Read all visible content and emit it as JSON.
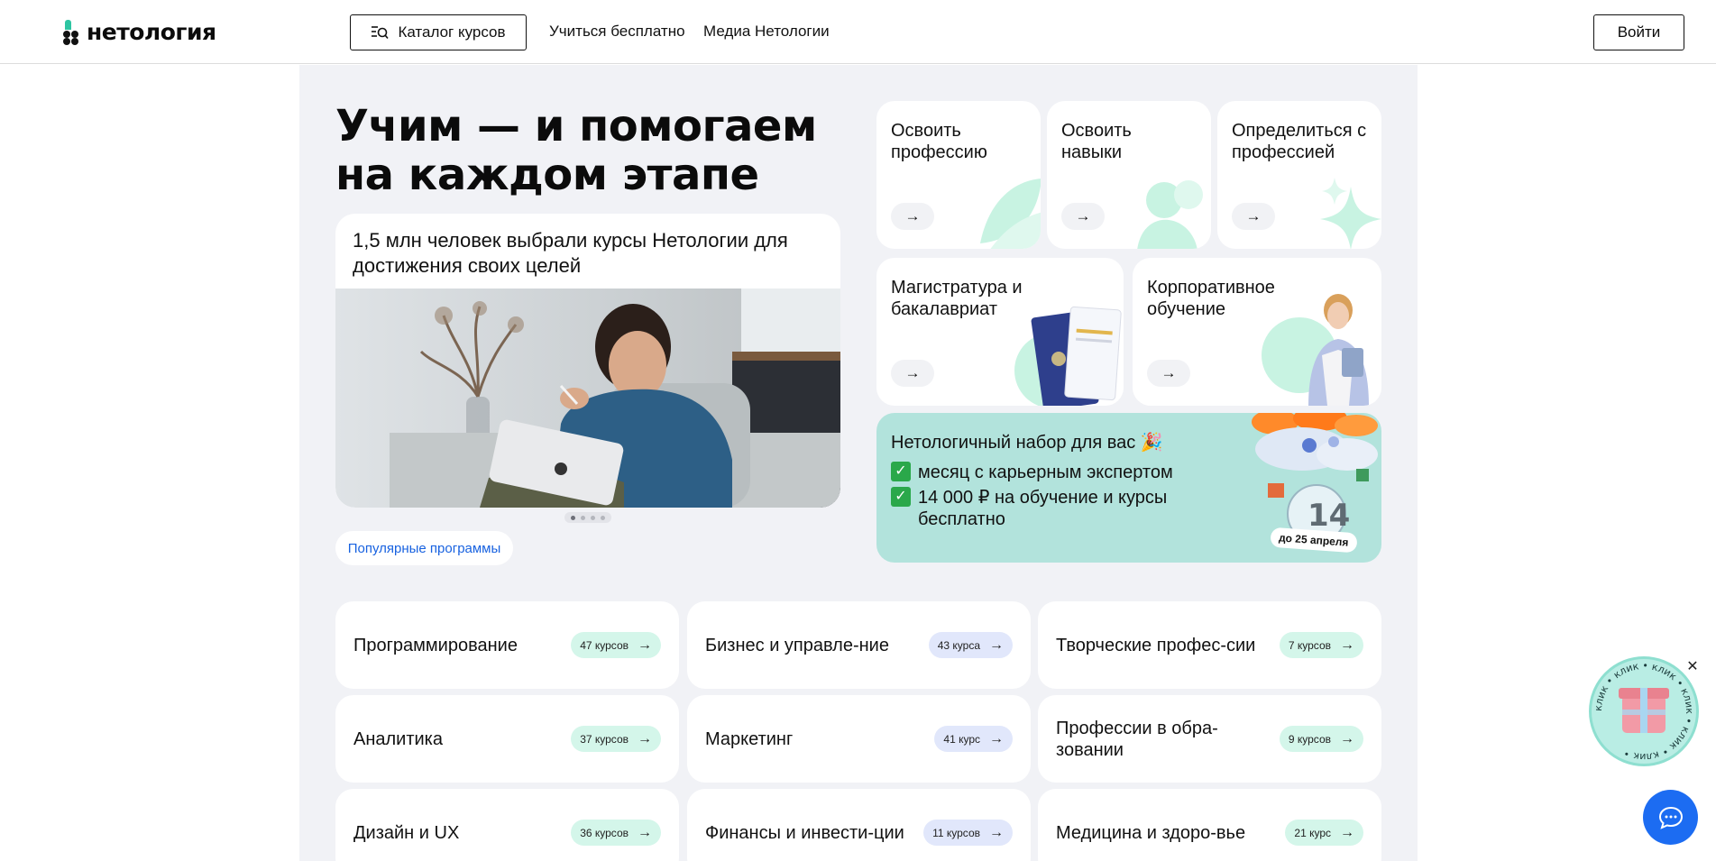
{
  "header": {
    "logo_text": "нетология",
    "catalog_label": "Каталог курсов",
    "nav": [
      "Учиться бесплатно",
      "Медиа Нетологии"
    ],
    "login_label": "Войти"
  },
  "hero": {
    "title": "Учим — и помогаем на каждом этапе",
    "story_text": "1,5 млн человек выбрали курсы Нетологии для достижения своих целей",
    "carousel": {
      "active": 1,
      "total": 4
    },
    "popular_label": "Популярные программы"
  },
  "directions": [
    {
      "title": "Освоить профессию",
      "accent": "#c8f3e2"
    },
    {
      "title": "Освоить навыки",
      "accent": "#c8f3e2"
    },
    {
      "title": "Определиться с профессией",
      "accent": "#c8f3e2"
    },
    {
      "title": "Магистратура и бакалавриат",
      "accent": "#c8f3e2"
    },
    {
      "title": "Корпоративное обучение",
      "accent": "#c8f3e2"
    }
  ],
  "promo": {
    "title": "Нетологичный набор для вас 🎉",
    "line1": "месяц с карьерным экспертом",
    "line2": "14 000 ₽ на обучение и курсы бесплатно",
    "badge_number": "14",
    "badge_text": "до 25 апреля",
    "bg_color": "#b2e3dc"
  },
  "categories": [
    {
      "name": "Программирование",
      "count": "47 курсов",
      "pill_color": "#d4f6ea"
    },
    {
      "name": "Бизнес и управле-ние",
      "count": "43 курса",
      "pill_color": "#e1e7fb"
    },
    {
      "name": "Творческие профес-сии",
      "count": "7 курсов",
      "pill_color": "#d4f6ea"
    },
    {
      "name": "Аналитика",
      "count": "37 курсов",
      "pill_color": "#d4f6ea"
    },
    {
      "name": "Маркетинг",
      "count": "41 курс",
      "pill_color": "#e1e7fb"
    },
    {
      "name": "Профессии в обра-зовании",
      "count": "9 курсов",
      "pill_color": "#d4f6ea"
    },
    {
      "name": "Дизайн и UX",
      "count": "36 курсов",
      "pill_color": "#d4f6ea"
    },
    {
      "name": "Финансы и инвести-ции",
      "count": "11 курсов",
      "pill_color": "#e1e7fb"
    },
    {
      "name": "Медицина и здоро-вье",
      "count": "21 курс",
      "pill_color": "#d4f6ea"
    }
  ],
  "widgets": {
    "gift_ring_text": "клик • клик • клик • клик • клик • клик •",
    "chat_color": "#1c6cf2"
  }
}
